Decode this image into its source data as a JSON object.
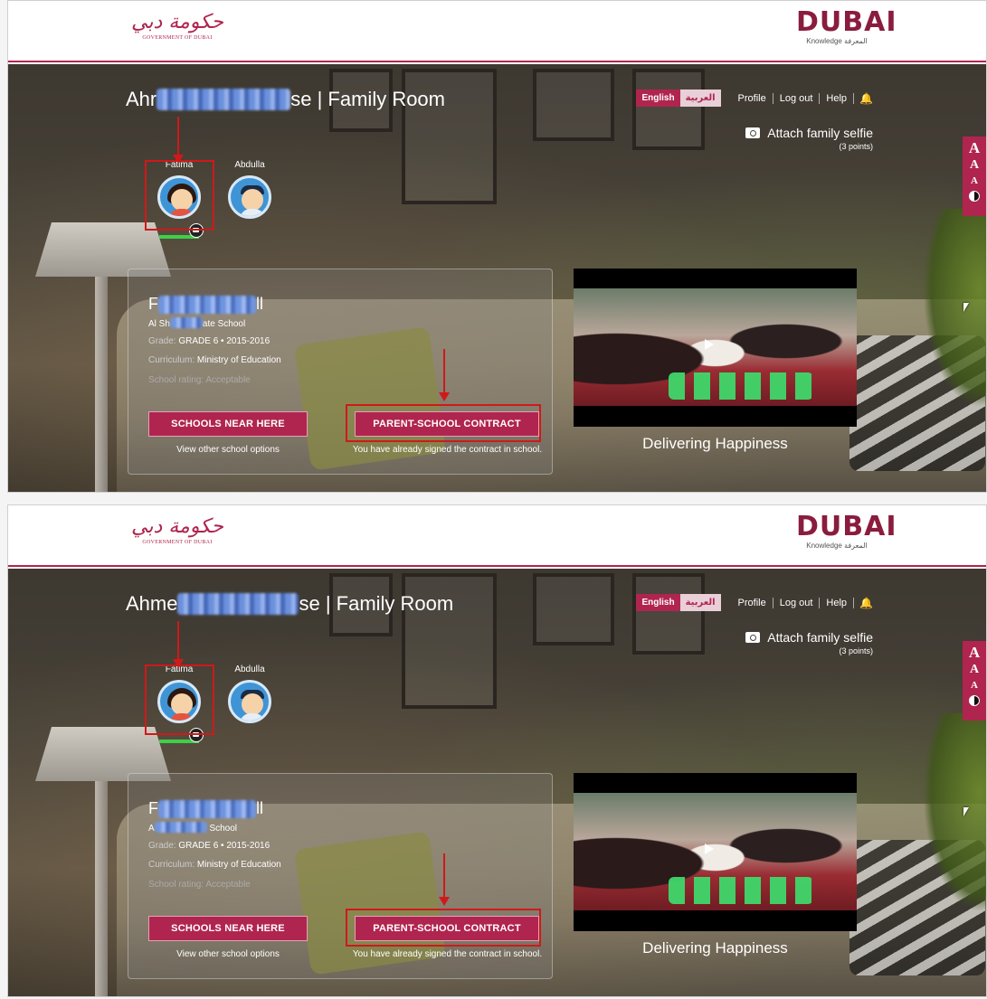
{
  "brand": {
    "gov_logo_arabic": "حكومة دبي",
    "gov_logo_english": "GOVERNMENT OF DUBAI",
    "kd_logo_main": "DUBAI",
    "kd_logo_sub": "Knowledge المعرفة"
  },
  "header": {
    "lang_english": "English",
    "lang_arabic": "العربية",
    "links": [
      "Profile",
      "Log out",
      "Help"
    ]
  },
  "selfie": {
    "label": "Attach family selfie",
    "points": "(3 points)"
  },
  "a11y": {
    "a_large": "A",
    "a_medium": "A",
    "a_small": "A"
  },
  "children": [
    {
      "name": "Fatima"
    },
    {
      "name": "Abdulla"
    }
  ],
  "card": {
    "grade_label": "Grade:",
    "grade_value": "GRADE 6 • 2015-2016",
    "curriculum_label": "Curriculum:",
    "curriculum_value": "Ministry of Education",
    "rating_label": "School rating:",
    "rating_value": "Acceptable",
    "btn_schools": "SCHOOLS NEAR HERE",
    "btn_schools_caption": "View other school options",
    "btn_contract": "PARENT-SCHOOL CONTRACT",
    "btn_contract_caption": "You have already signed the contract in school."
  },
  "video": {
    "caption": "Delivering Happiness"
  },
  "shots": [
    {
      "title_prefix": "Ahr",
      "title_suffix": "se | Family Room",
      "student_prefix": "F",
      "student_suffix": "ll",
      "school_prefix": "Al Sh",
      "school_suffix": "ate School"
    },
    {
      "title_prefix": "Ahme",
      "title_suffix": "se | Family Room",
      "student_prefix": "F",
      "student_suffix": "ll",
      "school_prefix": "A",
      "school_suffix": "School"
    }
  ]
}
